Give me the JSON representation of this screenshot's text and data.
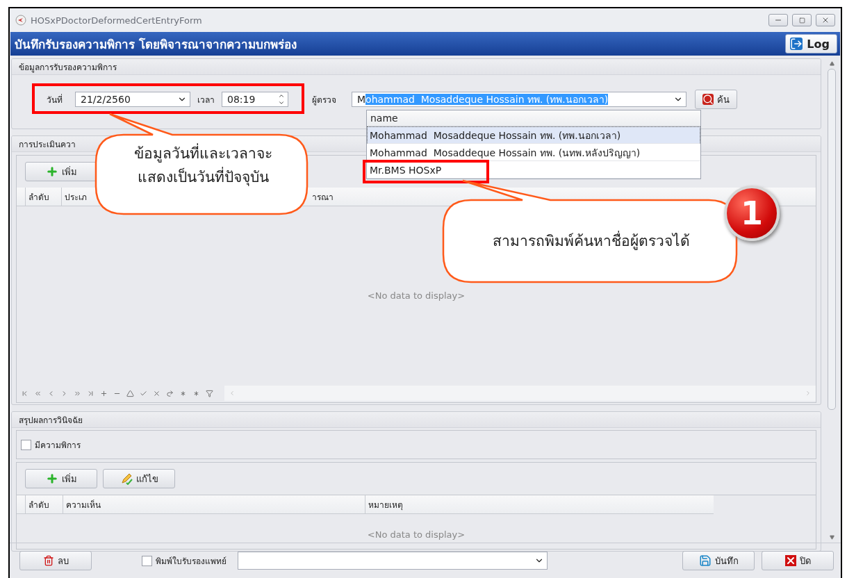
{
  "window": {
    "title": "HOSxPDoctorDeformedCertEntryForm"
  },
  "header": {
    "title": "บันทึกรับรองความพิการ โดยพิจารณาจากความบกพร่อง",
    "log_button": "Log"
  },
  "cert_info": {
    "title": "ข้อมูลการรับรองความพิการ",
    "date_label": "วันที่",
    "date": "21/2/2560",
    "time_label": "เวลา",
    "time": "08:19",
    "examiner_label": "ผู้ตรวจ",
    "examiner_typed": "M",
    "examiner_suggested": "ohammad  Mosaddeque Hossain ทพ. (ทพ.นอกเวลา)",
    "search_button": "ค้น",
    "dropdown": {
      "header": "name",
      "items": [
        {
          "label": "Mohammad  Mosaddeque Hossain ทพ. (ทพ.นอกเวลา)",
          "selected": true
        },
        {
          "label": "Mohammad  Mosaddeque Hossain ทพ. (นทพ.หลังปริญญา)",
          "selected": false
        },
        {
          "label": "Mr.BMS HOSxP",
          "selected": false
        }
      ]
    }
  },
  "assessment": {
    "title": "การประเมินควา",
    "add_button": "เพิ่ม",
    "columns": [
      "ลำดับ",
      "ประเภ",
      "ารณา"
    ],
    "empty": "<No data to display>"
  },
  "diagnosis": {
    "title": "สรุปผลการวินิจฉัย",
    "has_disability": {
      "label": "มีความพิการ",
      "checked": false
    },
    "add_button": "เพิ่ม",
    "edit_button": "แก้ไข",
    "columns": [
      "ลำดับ",
      "ความเห็น",
      "หมายเหตุ"
    ],
    "empty": "<No data to display>"
  },
  "footer": {
    "delete_button": "ลบ",
    "print_cert": {
      "label": "พิมพ์ใบรับรองแพทย์",
      "checked": false
    },
    "save_button": "บันทึก",
    "close_button": "ปิด"
  },
  "annotations": [
    {
      "kind": "callout",
      "lines": [
        "ข้อมูลวันที่และเวลาจะ",
        "แสดงเป็นวันที่ปัจจุบัน"
      ]
    },
    {
      "kind": "callout",
      "lines": [
        "สามารถพิมพ์ค้นหาชื่อผู้ตรวจได้"
      ]
    },
    {
      "kind": "badge",
      "text": "1"
    }
  ]
}
